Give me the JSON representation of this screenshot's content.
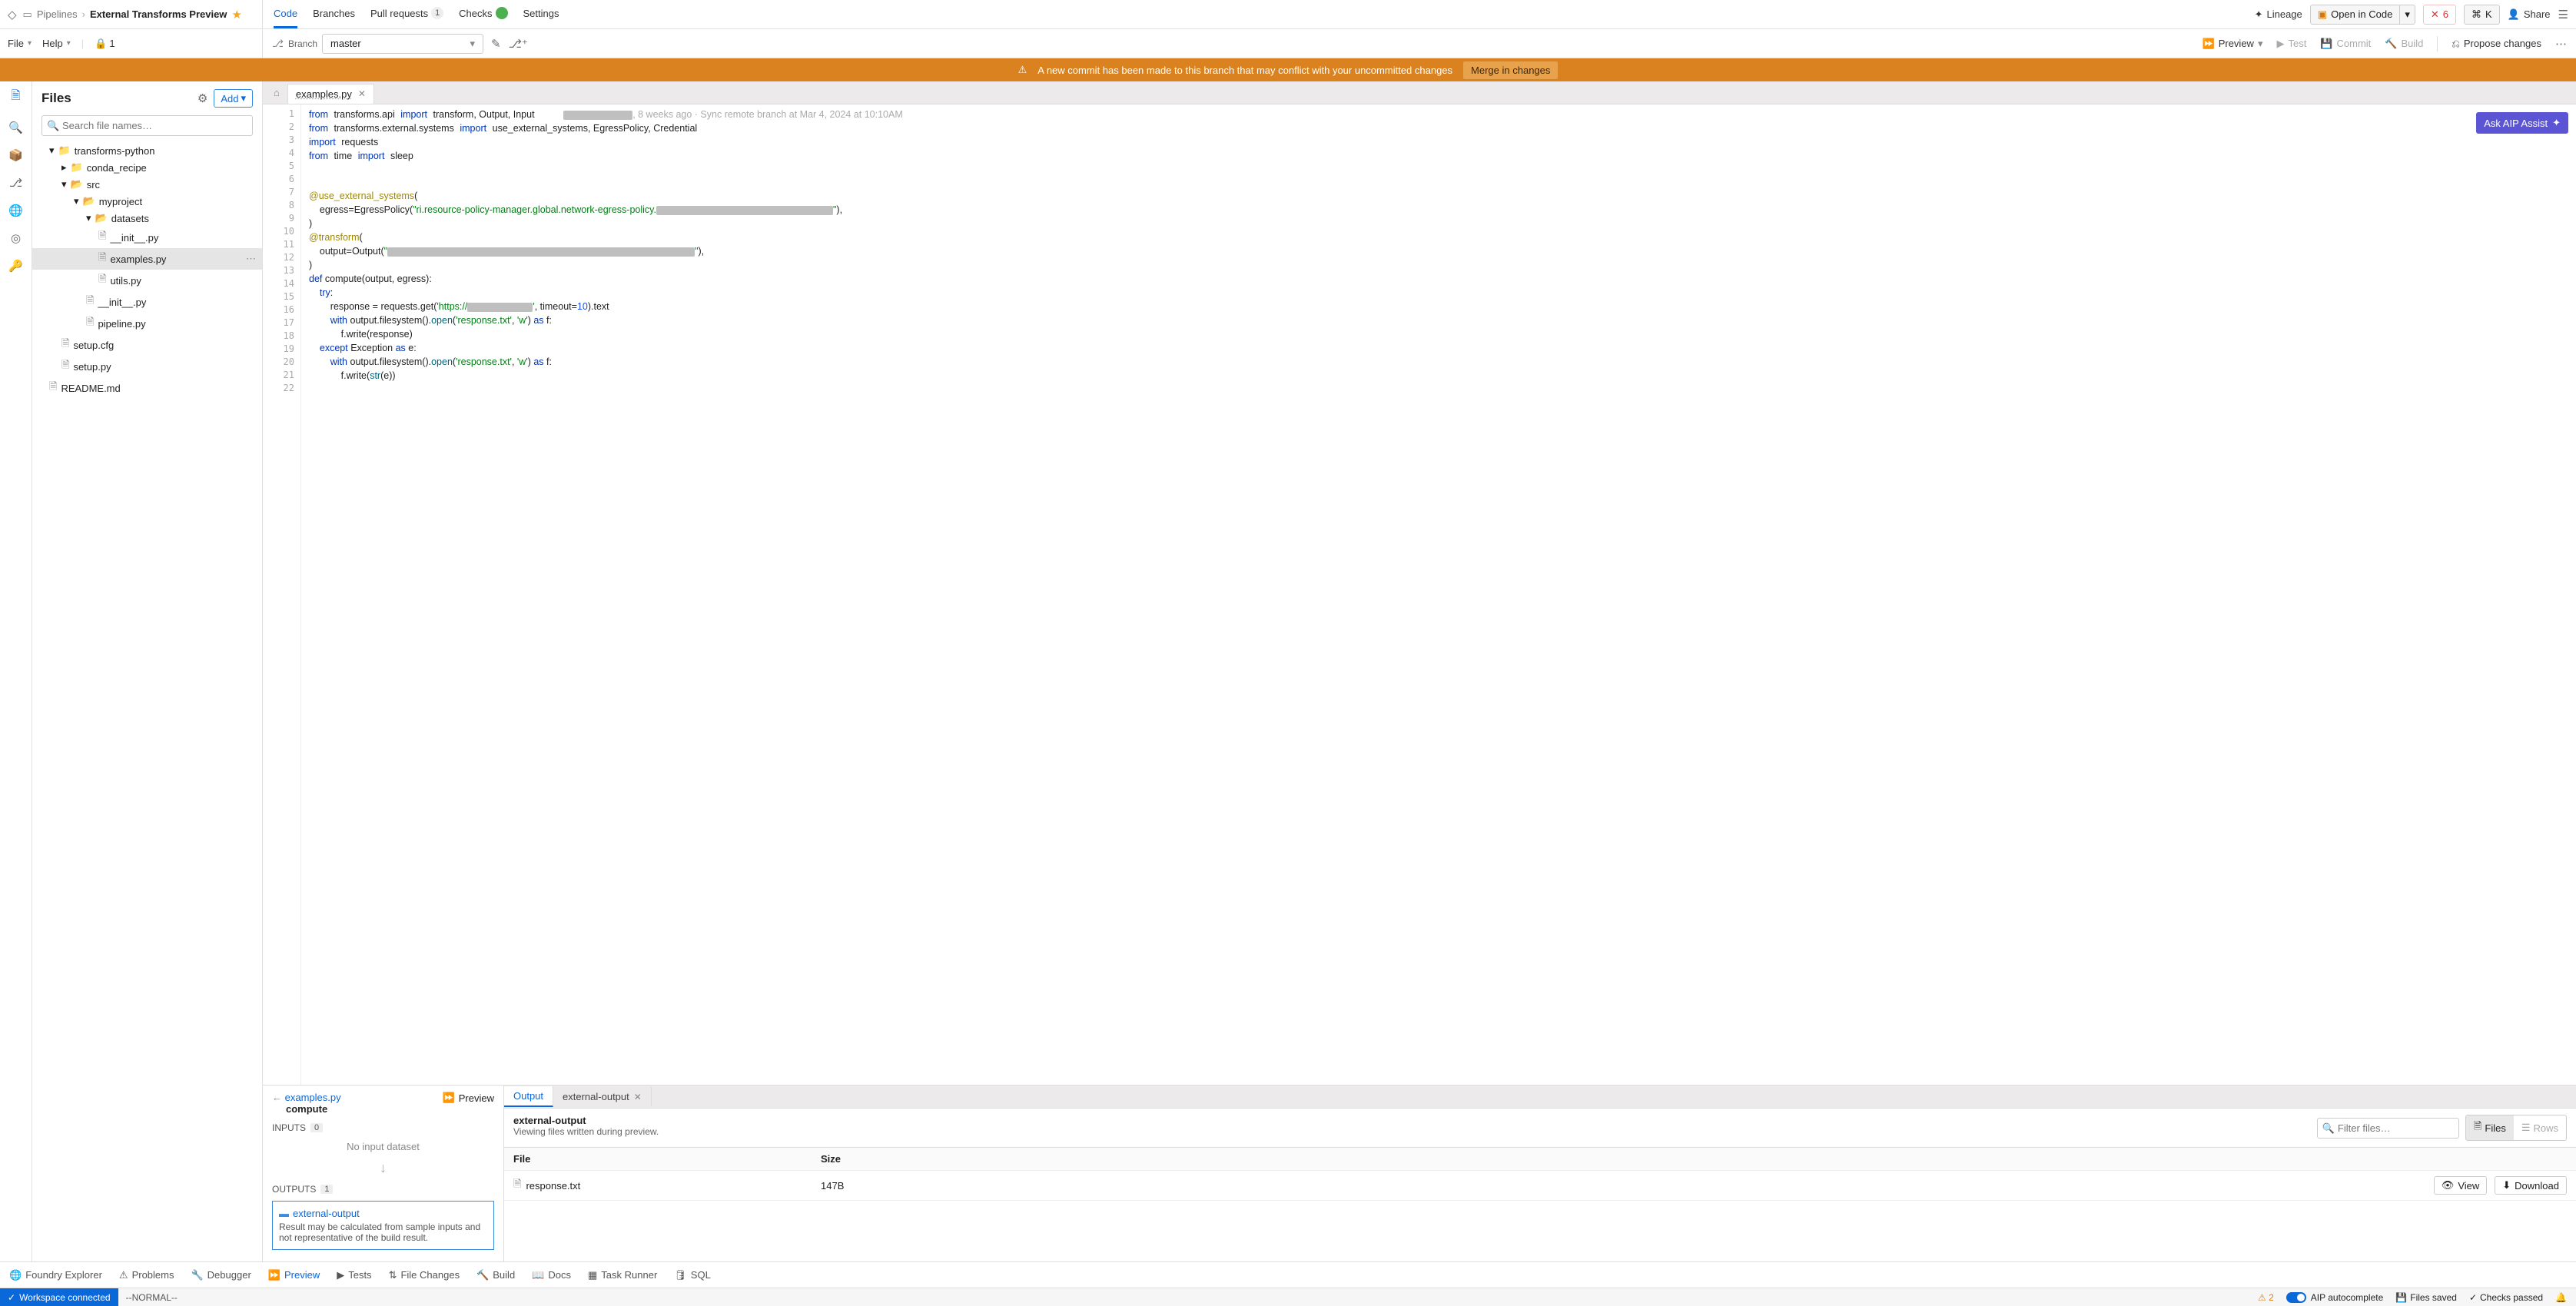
{
  "breadcrumb": {
    "parent": "Pipelines",
    "current": "External Transforms Preview"
  },
  "top_tabs": {
    "code": "Code",
    "branches": "Branches",
    "pull": "Pull requests",
    "pull_count": "1",
    "checks": "Checks",
    "settings": "Settings"
  },
  "top_right": {
    "lineage": "Lineage",
    "open_in_code": "Open in Code",
    "errs": "6",
    "shortcut": "K",
    "share": "Share"
  },
  "menus": {
    "file": "File",
    "help": "Help",
    "lock_count": "1"
  },
  "branch": {
    "label": "Branch",
    "value": "master"
  },
  "actions": {
    "preview": "Preview",
    "test": "Test",
    "commit": "Commit",
    "build": "Build",
    "propose": "Propose changes"
  },
  "banner": {
    "msg": "A new commit has been made to this branch that may conflict with your uncommitted changes",
    "btn": "Merge in changes"
  },
  "files_panel": {
    "title": "Files",
    "add": "Add",
    "search_ph": "Search file names…"
  },
  "tree": {
    "root": "transforms-python",
    "conda": "conda_recipe",
    "src": "src",
    "myproject": "myproject",
    "datasets": "datasets",
    "init1": "__init__.py",
    "examples": "examples.py",
    "utils": "utils.py",
    "init2": "__init__.py",
    "pipeline": "pipeline.py",
    "setupcfg": "setup.cfg",
    "setuppy": "setup.py",
    "readme": "README.md"
  },
  "editor_tab": {
    "name": "examples.py"
  },
  "aip": {
    "label": "Ask AIP Assist"
  },
  "blame": {
    "text": ", 8 weeks ago · Sync remote branch at Mar 4, 2024 at 10:10AM"
  },
  "code": {
    "l1a": "from",
    "l1b": "transforms.api",
    "l1c": "import",
    "l1d": "transform, Output, Input",
    "l2a": "from",
    "l2b": "transforms.external.systems",
    "l2c": "import",
    "l2d": "use_external_systems, EgressPolicy, Credential",
    "l3a": "import",
    "l3b": "requests",
    "l4a": "from",
    "l4b": "time",
    "l4c": "import",
    "l4d": "sleep",
    "l7": "@use_external_systems",
    "l7p": "(",
    "l8a": "    egress=EgressPolicy(",
    "l8b": "\"ri.resource-policy-manager.global.network-egress-policy.",
    "l8c": "\"",
    "l8d": "),",
    "l9": ")",
    "l10": "@transform",
    "l10p": "(",
    "l11a": "    output=Output(",
    "l11b": "\"",
    "l11c": "\"",
    "l11d": "),",
    "l12": ")",
    "l13a": "def",
    "l13b": " compute(output, egress):",
    "l14a": "    try",
    "l14b": ":",
    "l15a": "        response = requests.get(",
    "l15b": "'https://",
    "l15c": "'",
    "l15d": ", timeout=",
    "l15e": "10",
    "l15f": ").text",
    "l16a": "        with",
    "l16b": " output.filesystem().",
    "l16c": "open",
    "l16d": "(",
    "l16e": "'response.txt'",
    "l16f": ", ",
    "l16g": "'w'",
    "l16h": ") ",
    "l16i": "as",
    "l16j": " f:",
    "l17": "            f.write(response)",
    "l18a": "    except",
    "l18b": " Exception ",
    "l18c": "as",
    "l18d": " e:",
    "l19a": "        with",
    "l19b": " output.filesystem().",
    "l19c": "open",
    "l19d": "(",
    "l19e": "'response.txt'",
    "l19f": ", ",
    "l19g": "'w'",
    "l19h": ") ",
    "l19i": "as",
    "l19j": " f:",
    "l20a": "            f.write(",
    "l20b": "str",
    "l20c": "(e))"
  },
  "io": {
    "file": "examples.py",
    "fn": "compute",
    "preview": "Preview",
    "inputs": "INPUTS",
    "in_count": "0",
    "no_input": "No input dataset",
    "outputs": "OUTPUTS",
    "out_count": "1",
    "out_name": "external-output",
    "out_desc": "Result may be calculated from sample inputs and not representative of the build result."
  },
  "results": {
    "tab1": "Output",
    "tab2": "external-output",
    "title": "external-output",
    "desc": "Viewing files written during preview.",
    "filter_ph": "Filter files…",
    "files_btn": "Files",
    "rows_btn": "Rows",
    "col_file": "File",
    "col_size": "Size",
    "row_file": "response.txt",
    "row_size": "147B",
    "view": "View",
    "download": "Download"
  },
  "bottom_tabs": {
    "explorer": "Foundry Explorer",
    "problems": "Problems",
    "debugger": "Debugger",
    "preview": "Preview",
    "tests": "Tests",
    "file_changes": "File Changes",
    "build": "Build",
    "docs": "Docs",
    "task": "Task Runner",
    "sql": "SQL"
  },
  "status": {
    "ws": "Workspace connected",
    "mode": "--NORMAL--",
    "warn": "2",
    "aip": "AIP autocomplete",
    "saved": "Files saved",
    "checks": "Checks passed"
  }
}
